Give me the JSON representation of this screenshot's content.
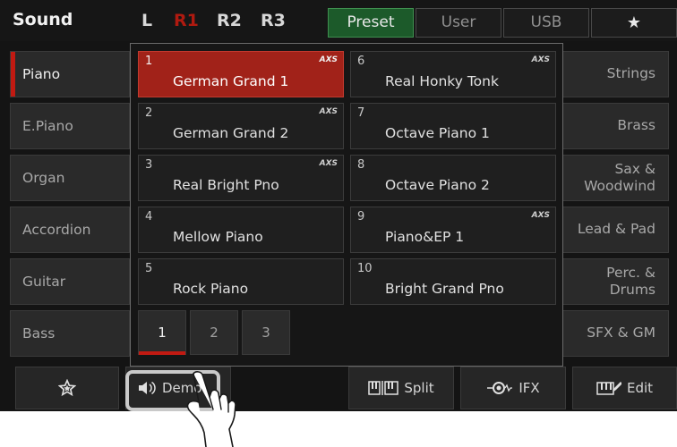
{
  "app": {
    "title": "Sound"
  },
  "registrations": [
    "L",
    "R1",
    "R2",
    "R3"
  ],
  "active_registration": "R1",
  "banks": {
    "preset": "Preset",
    "user": "User",
    "usb": "USB",
    "favorites_icon": "star-icon",
    "active": "Preset"
  },
  "categories_left": [
    {
      "label": "Piano",
      "active": true
    },
    {
      "label": "E.Piano"
    },
    {
      "label": "Organ"
    },
    {
      "label": "Accordion"
    },
    {
      "label": "Guitar"
    },
    {
      "label": "Bass"
    }
  ],
  "categories_right": [
    {
      "label": "Strings"
    },
    {
      "label": "Brass"
    },
    {
      "label_line1": "Sax &",
      "label_line2": "Woodwind"
    },
    {
      "label": "Lead & Pad"
    },
    {
      "label_line1": "Perc. &",
      "label_line2": "Drums"
    },
    {
      "label": "SFX & GM"
    }
  ],
  "voices": [
    {
      "num": "1",
      "name": "German Grand 1",
      "axs": "AXS",
      "active": true
    },
    {
      "num": "2",
      "name": "German Grand 2",
      "axs": "AXS"
    },
    {
      "num": "3",
      "name": "Real Bright Pno",
      "axs": "AXS"
    },
    {
      "num": "4",
      "name": "Mellow Piano"
    },
    {
      "num": "5",
      "name": "Rock Piano"
    },
    {
      "num": "6",
      "name": "Real Honky Tonk",
      "axs": "AXS"
    },
    {
      "num": "7",
      "name": "Octave Piano 1"
    },
    {
      "num": "8",
      "name": "Octave Piano 2"
    },
    {
      "num": "9",
      "name": "Piano&EP 1",
      "axs": "AXS"
    },
    {
      "num": "10",
      "name": "Bright Grand Pno"
    }
  ],
  "pages": [
    "1",
    "2",
    "3"
  ],
  "active_page": "1",
  "bottom": {
    "favorite_icon": "star-icon",
    "demo_label": "Demo",
    "split_label": "Split",
    "ifx_label": "IFX",
    "edit_label": "Edit"
  },
  "colors": {
    "accent_red": "#c11a12",
    "active_bank_green": "#1c5a2a",
    "background": "#141414"
  }
}
